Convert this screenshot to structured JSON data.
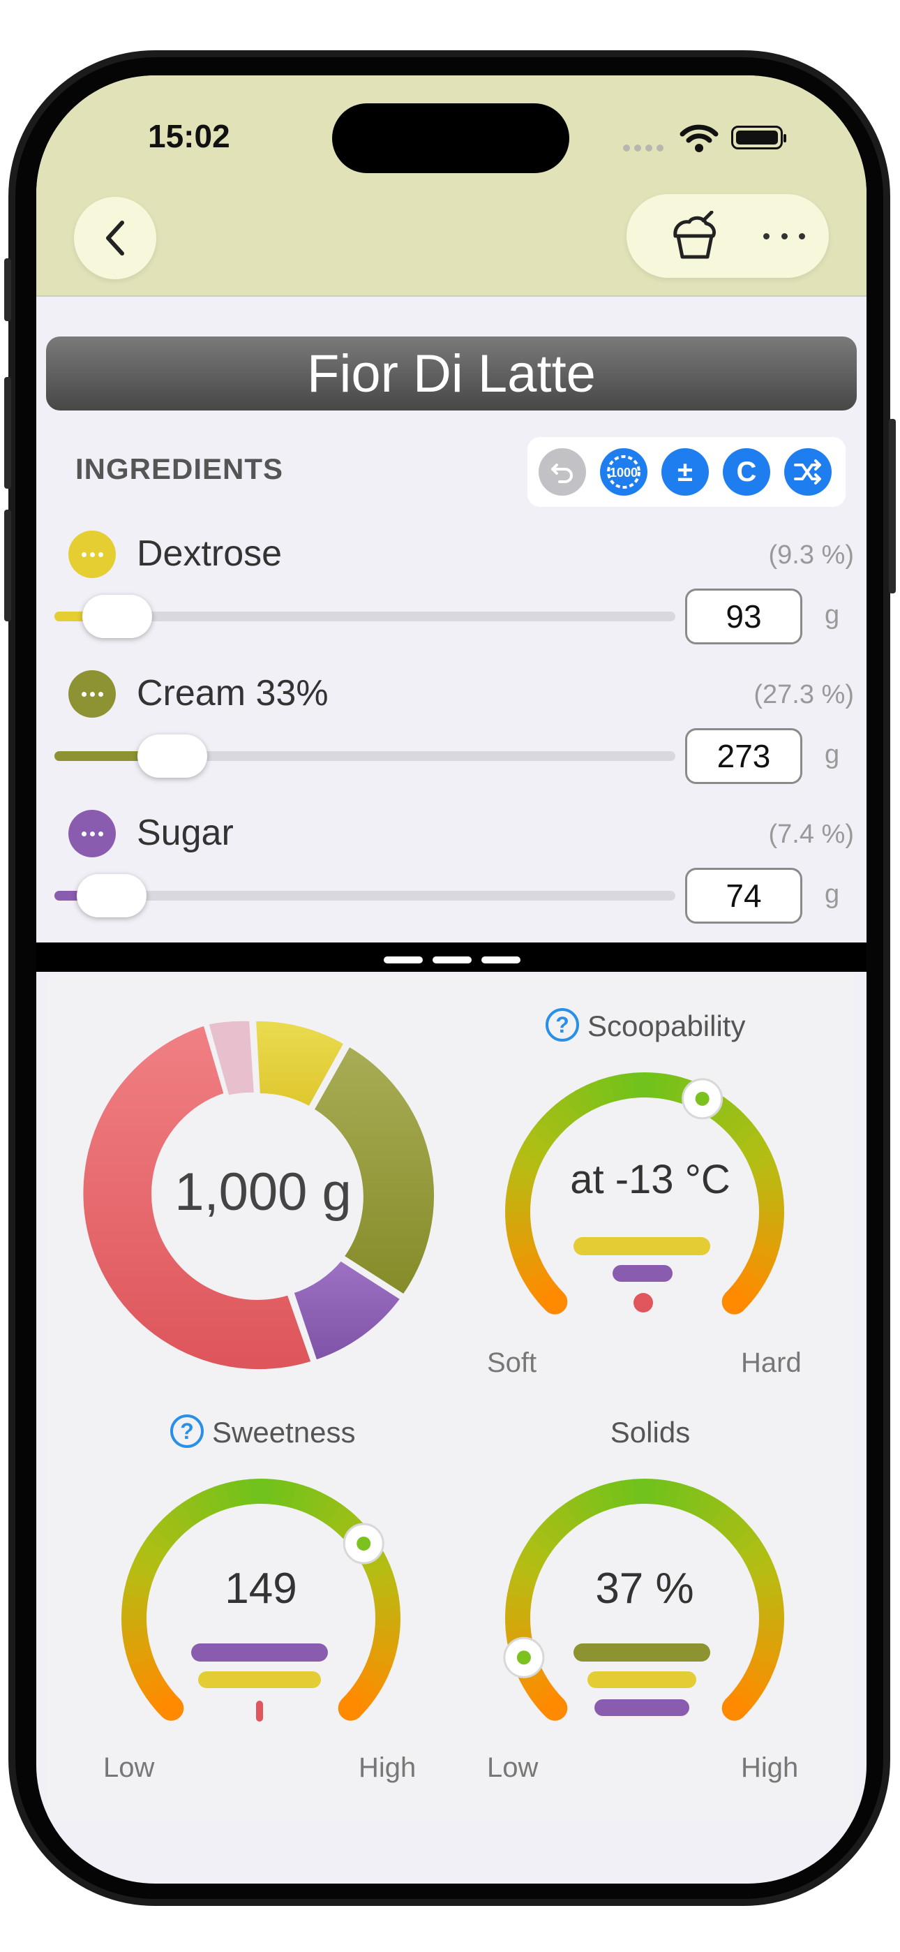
{
  "status_bar": {
    "time": "15:02"
  },
  "recipe": {
    "title": "Fior Di Latte"
  },
  "ingredients": {
    "header": "INGREDIENTS",
    "tools": [
      {
        "name": "undo",
        "label": "↶",
        "color": "#c2c2c6"
      },
      {
        "name": "scale-1000",
        "label": "1000",
        "color": "#1e7ef0"
      },
      {
        "name": "plus-minus",
        "label": "±",
        "color": "#1e7ef0"
      },
      {
        "name": "c",
        "label": "C",
        "color": "#1e7ef0"
      },
      {
        "name": "shuffle",
        "label": "⤨",
        "color": "#1e7ef0"
      }
    ],
    "items": [
      {
        "name": "Dextrose",
        "percent": "(9.3 %)",
        "grams": "93",
        "unit": "g",
        "color": "#e4ce31",
        "slider_fraction": 0.093
      },
      {
        "name": "Cream 33%",
        "percent": "(27.3 %)",
        "grams": "273",
        "unit": "g",
        "color": "#8d9332",
        "slider_fraction": 0.273
      },
      {
        "name": "Sugar",
        "percent": "(7.4 %)",
        "grams": "74",
        "unit": "g",
        "color": "#8a5cb0",
        "slider_fraction": 0.074
      }
    ]
  },
  "summary": {
    "total": "1,000 g",
    "donut_colors": {
      "main": "#e0565c",
      "pink": "#e8bfcd",
      "yellow": "#e4cd34",
      "olive": "#8d9330",
      "purple": "#8a5cb0"
    }
  },
  "scoopability": {
    "title": "Scoopability",
    "value": "at -13 °C",
    "low": "Soft",
    "high": "Hard",
    "indicator_fraction": 0.6
  },
  "sweetness": {
    "title": "Sweetness",
    "value": "149",
    "low": "Low",
    "high": "High",
    "indicator_fraction": 0.7
  },
  "solids": {
    "title": "Solids",
    "value": "37 %",
    "low": "Low",
    "high": "High",
    "indicator_fraction": 0.1
  }
}
